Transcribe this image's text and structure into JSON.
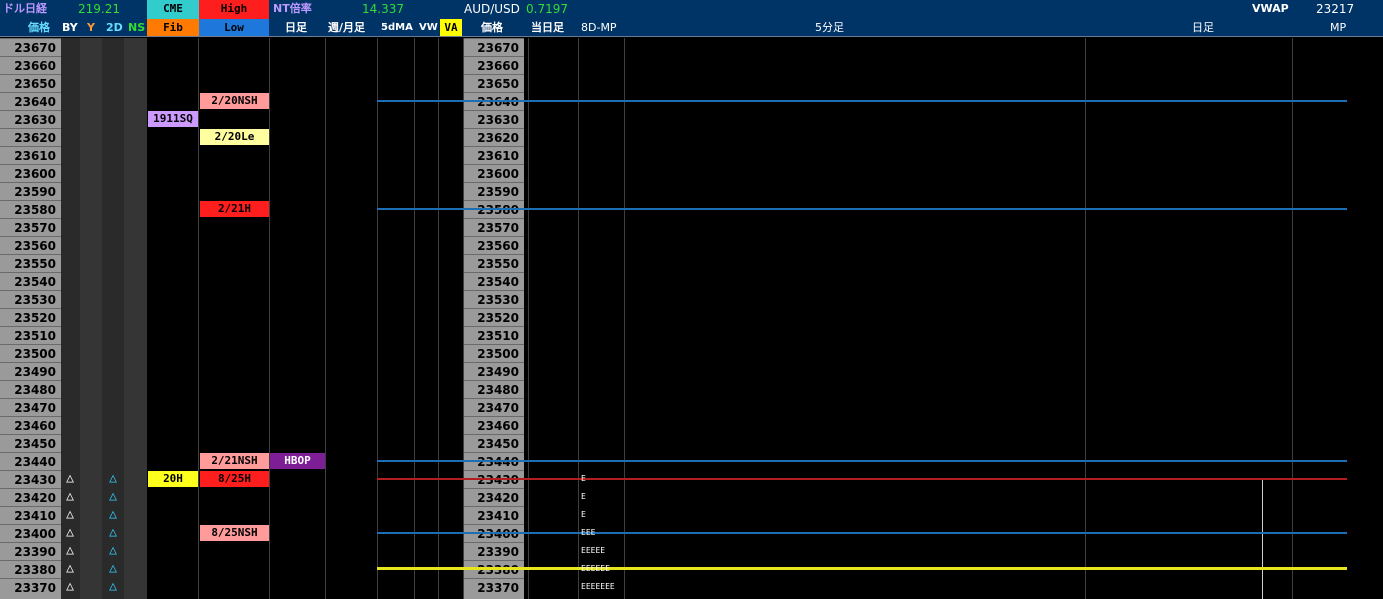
{
  "header_top": {
    "dollar_nikkei_label": "ドル日経",
    "dollar_nikkei_value": "219.21",
    "cme_label": "CME",
    "high_label": "High",
    "nt_ratio_label": "NT倍率",
    "nt_ratio_value": "14.337",
    "aud_usd_label": "AUD/USD",
    "aud_usd_value": "0.7197",
    "vwap_label": "VWAP",
    "vwap_value": "23217"
  },
  "header_bottom": {
    "price_label": "価格",
    "by_label": "BY",
    "y_label": "Y",
    "twod_label": "2D",
    "ns_label": "NS",
    "fib_label": "Fib",
    "low_label": "Low",
    "daily_label": "日足",
    "weekly_monthly_label": "週/月足",
    "ma5d_label": "5dMA",
    "vw_label": "VW",
    "va_label": "VA",
    "price2_label": "価格",
    "today_daily_label": "当日足",
    "mp8d_label": "8D-MP",
    "fivemin_label": "5分足",
    "daily2_label": "日足",
    "mp_label": "MP"
  },
  "prices": [
    "23670",
    "23660",
    "23650",
    "23640",
    "23630",
    "23620",
    "23610",
    "23600",
    "23590",
    "23580",
    "23570",
    "23560",
    "23550",
    "23540",
    "23530",
    "23520",
    "23510",
    "23500",
    "23490",
    "23480",
    "23470",
    "23460",
    "23450",
    "23440",
    "23430",
    "23420",
    "23410",
    "23400",
    "23390",
    "23380",
    "23370"
  ],
  "triangle_rows": [
    24,
    25,
    26,
    27,
    28,
    29,
    30
  ],
  "triangle_symbol": "△",
  "tags": [
    {
      "row": 3,
      "col": "low",
      "text": "2/20NSH",
      "bg": "#ff9b9b",
      "fg": "#000000"
    },
    {
      "row": 4,
      "col": "fib",
      "text": "1911SQ",
      "bg": "#cc99ff",
      "fg": "#000000"
    },
    {
      "row": 5,
      "col": "low",
      "text": "2/20Le",
      "bg": "#ffffa0",
      "fg": "#000000"
    },
    {
      "row": 9,
      "col": "low",
      "text": "2/21H",
      "bg": "#ff1e1e",
      "fg": "#000000"
    },
    {
      "row": 23,
      "col": "low",
      "text": "2/21NSH",
      "bg": "#ff9b9b",
      "fg": "#000000"
    },
    {
      "row": 23,
      "col": "daily",
      "text": "HBOP",
      "bg": "#7d1e96",
      "fg": "#ffffff"
    },
    {
      "row": 24,
      "col": "fib",
      "text": "20H",
      "bg": "#ffff1e",
      "fg": "#000000"
    },
    {
      "row": 24,
      "col": "low",
      "text": "8/25H",
      "bg": "#ff1e1e",
      "fg": "#000000"
    },
    {
      "row": 27,
      "col": "low",
      "text": "8/25NSH",
      "bg": "#ff9b9b",
      "fg": "#000000"
    }
  ],
  "levels": [
    {
      "row": 3,
      "color": "#1e6eb4"
    },
    {
      "row": 9,
      "color": "#1e6eb4"
    },
    {
      "row": 23,
      "color": "#1e6eb4"
    },
    {
      "row": 24,
      "color": "#b41e1e"
    },
    {
      "row": 27,
      "color": "#1e6eb4"
    },
    {
      "row": 28.95,
      "color": "#e6e61e"
    }
  ],
  "mp_letters": [
    {
      "row": 24,
      "text": "E"
    },
    {
      "row": 25,
      "text": "E"
    },
    {
      "row": 26,
      "text": "E"
    },
    {
      "row": 27,
      "text": "EEE"
    },
    {
      "row": 28,
      "text": "EEEEE"
    },
    {
      "row": 29,
      "text": "EEEEEE"
    },
    {
      "row": 30,
      "text": "EEEEEEE"
    }
  ],
  "colors": {
    "header_bg": "#003366",
    "price_cell_bg": "#9a9a9a",
    "triangle_white": "#ffffff",
    "triangle_cyan": "#33ccff",
    "label_cyan": "#66ddff",
    "label_green": "#33dd33",
    "label_orange": "#ff9933",
    "label_lilac": "#bb99ff"
  }
}
